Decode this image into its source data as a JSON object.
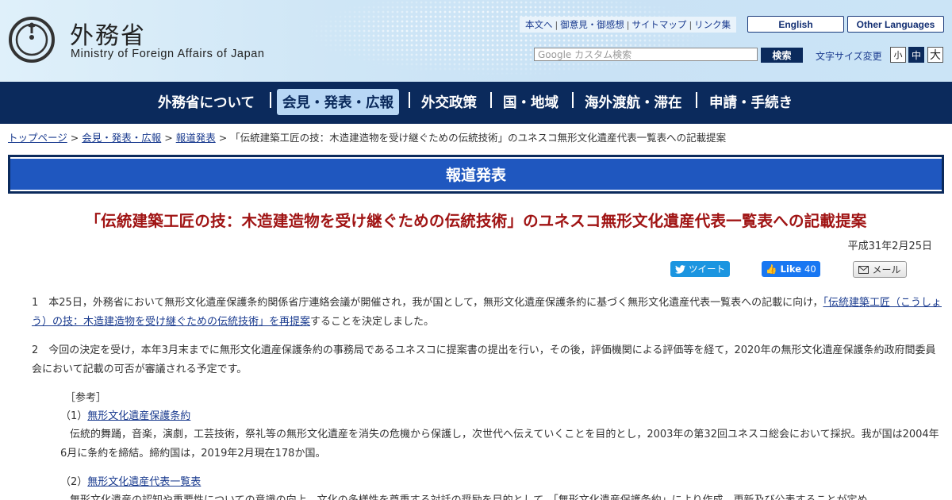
{
  "header": {
    "logo_jp": "外務省",
    "logo_en": "Ministry of Foreign Affairs of Japan",
    "util_links": [
      "本文へ",
      "御意見・御感想",
      "サイトマップ",
      "リンク集"
    ],
    "lang_english": "English",
    "lang_other": "Other Languages",
    "search_placeholder": "Google カスタム検索",
    "search_button": "検索",
    "fontsize_label": "文字サイズ変更",
    "fontsize_small": "小",
    "fontsize_medium": "中",
    "fontsize_large": "大"
  },
  "gnav": {
    "items": [
      "外務省について",
      "会見・発表・広報",
      "外交政策",
      "国・地域",
      "海外渡航・滞在",
      "申請・手続き"
    ],
    "active_index": 1
  },
  "breadcrumb": {
    "items": [
      "トップページ",
      "会見・発表・広報",
      "報道発表"
    ],
    "separator": ">",
    "current": "「伝統建築工匠の技：木造建造物を受け継ぐための伝統技術」のユネスコ無形文化遺産代表一覧表への記載提案"
  },
  "section": {
    "title": "報道発表"
  },
  "article": {
    "title": "「伝統建築工匠の技：木造建造物を受け継ぐための伝統技術」のユネスコ無形文化遺産代表一覧表への記載提案",
    "date": "平成31年2月25日"
  },
  "social": {
    "tweet": "ツイート",
    "like": "Like",
    "like_count": "40",
    "mail": "メール"
  },
  "body": {
    "p1_before": "1　本25日，外務省において無形文化遺産保護条約関係省庁連絡会議が開催され，我が国として，無形文化遺産保護条約に基づく無形文化遺産代表一覧表への記載に向け，",
    "p1_link": "「伝統建築工匠（こうしょう）の技：木造建造物を受け継ぐための伝統技術」を再提案",
    "p1_after": "することを決定しました。",
    "p2": "2　今回の決定を受け，本年3月末までに無形文化遺産保護条約の事務局であるユネスコに提案書の提出を行い，その後，評価機関による評価等を経て，2020年の無形文化遺産保護条約政府間委員会において記載の可否が審議される予定です。",
    "ref_head": "［参考］",
    "ref1_num": "（1）",
    "ref1_link": "無形文化遺産保護条約",
    "ref1_body": "伝統的舞踊，音楽，演劇，工芸技術，祭礼等の無形文化遺産を消失の危機から保護し，次世代へ伝えていくことを目的とし，2003年の第32回ユネスコ総会において採択。我が国は2004年6月に条約を締結。締約国は，2019年2月現在178か国。",
    "ref2_num": "（2）",
    "ref2_link": "無形文化遺産代表一覧表",
    "ref2_body": "無形文化遺産の認知や重要性についての意識の向上，文化の多様性を尊重する対話の奨励を目的として，「無形文化遺産保護条約」により作成，更新及び公表することが定め"
  },
  "colors": {
    "nav_bg": "#0b2a5c",
    "banner_bg": "#1f57bf",
    "title_red": "#a01414",
    "link_blue": "#1a3b8f"
  }
}
